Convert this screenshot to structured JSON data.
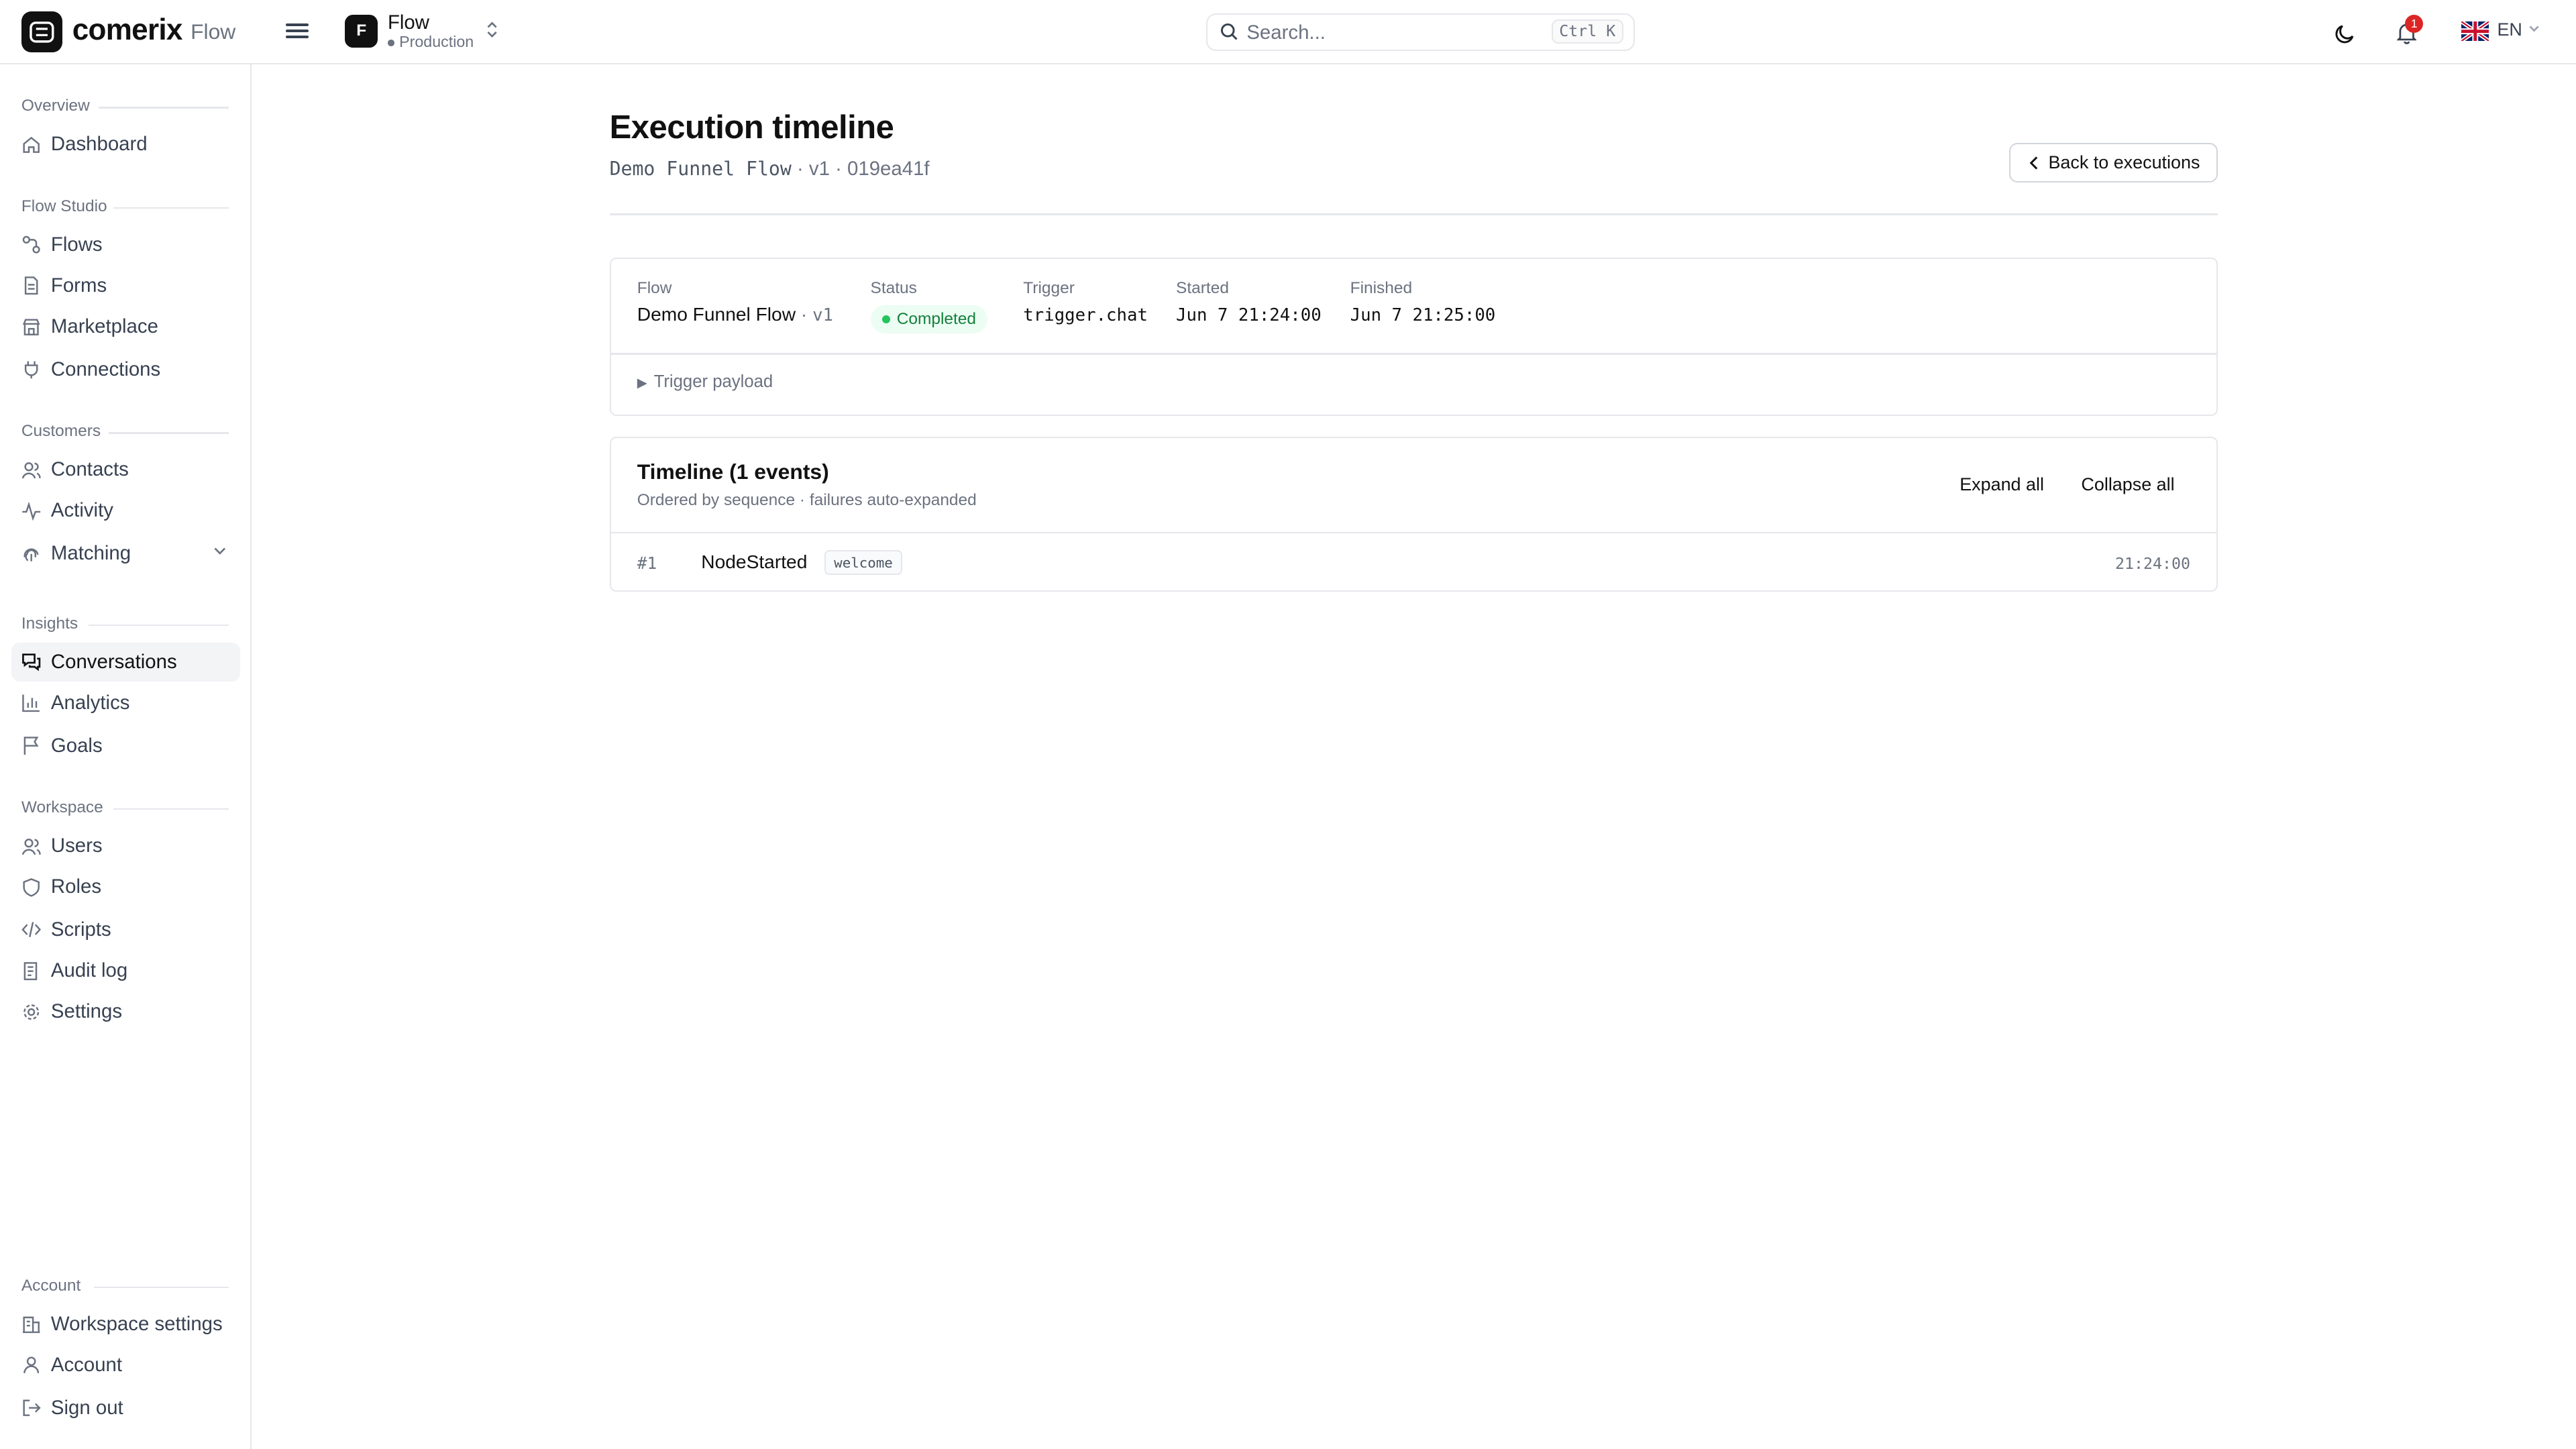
{
  "app": {
    "brand": "comerix",
    "product": "Flow",
    "workspace": {
      "initial": "F",
      "name": "Flow",
      "environment": "Production"
    },
    "search": {
      "placeholder": "Search...",
      "shortcut": "Ctrl K"
    },
    "notifications_count": "1",
    "language": "EN"
  },
  "sidebar": {
    "sections": [
      {
        "label": "Overview",
        "items": [
          {
            "label": "Dashboard",
            "icon": "home-icon"
          }
        ]
      },
      {
        "label": "Flow Studio",
        "items": [
          {
            "label": "Flows",
            "icon": "flow-icon"
          },
          {
            "label": "Forms",
            "icon": "form-icon"
          },
          {
            "label": "Marketplace",
            "icon": "store-icon"
          },
          {
            "label": "Connections",
            "icon": "plug-icon"
          }
        ]
      },
      {
        "label": "Customers",
        "items": [
          {
            "label": "Contacts",
            "icon": "contacts-icon"
          },
          {
            "label": "Activity",
            "icon": "activity-icon"
          },
          {
            "label": "Matching",
            "icon": "fingerprint-icon"
          }
        ]
      },
      {
        "label": "Insights",
        "items": [
          {
            "label": "Conversations",
            "icon": "chat-icon",
            "active": true
          },
          {
            "label": "Analytics",
            "icon": "chart-icon"
          },
          {
            "label": "Goals",
            "icon": "flag-icon"
          }
        ]
      },
      {
        "label": "Workspace",
        "items": [
          {
            "label": "Users",
            "icon": "users-icon"
          },
          {
            "label": "Roles",
            "icon": "shield-icon"
          },
          {
            "label": "Scripts",
            "icon": "code-icon"
          },
          {
            "label": "Audit log",
            "icon": "audit-icon"
          },
          {
            "label": "Settings",
            "icon": "gear-icon"
          }
        ]
      },
      {
        "label": "Account",
        "items": [
          {
            "label": "Workspace settings",
            "icon": "building-icon"
          },
          {
            "label": "Account",
            "icon": "user-icon"
          },
          {
            "label": "Sign out",
            "icon": "logout-icon"
          }
        ]
      }
    ]
  },
  "page": {
    "title": "Execution timeline",
    "subtitle": {
      "flow": "Demo Funnel Flow",
      "rest": " · v1 · 019ea41f"
    },
    "back_button": "Back to executions"
  },
  "summary": {
    "flow": {
      "label": "Flow",
      "name": "Demo Funnel Flow",
      "version": "v1"
    },
    "status": {
      "label": "Status",
      "value": "Completed",
      "color": "#15803d"
    },
    "trigger": {
      "label": "Trigger",
      "value": "trigger.chat"
    },
    "started": {
      "label": "Started",
      "value": "Jun 7 21:24:00"
    },
    "finished": {
      "label": "Finished",
      "value": "Jun 7 21:25:00"
    },
    "payload_toggle": "Trigger payload"
  },
  "timeline": {
    "title": "Timeline (1 events)",
    "subtitle": "Ordered by sequence · failures auto-expanded",
    "expand_all": "Expand all",
    "collapse_all": "Collapse all",
    "events": [
      {
        "seq": "#1",
        "type": "NodeStarted",
        "node": "welcome",
        "time": "21:24:00"
      }
    ]
  }
}
